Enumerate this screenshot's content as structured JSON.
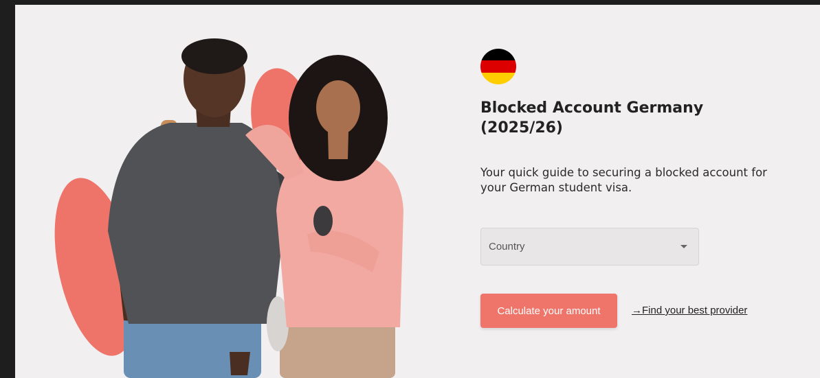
{
  "hero": {
    "title": "Blocked Account Germany (2025/26)",
    "subtitle": "Your quick guide to securing a blocked account for your German student visa.",
    "flag_icon": "germany-flag-icon",
    "flag_colors": [
      "#000000",
      "#dd0000",
      "#ffce00"
    ]
  },
  "form": {
    "country_placeholder": "Country",
    "calculate_label": "Calculate your amount",
    "provider_link_label": "→Find your best provider"
  },
  "colors": {
    "accent": "#ef756a",
    "background": "#f1eff0",
    "text": "#222222"
  }
}
